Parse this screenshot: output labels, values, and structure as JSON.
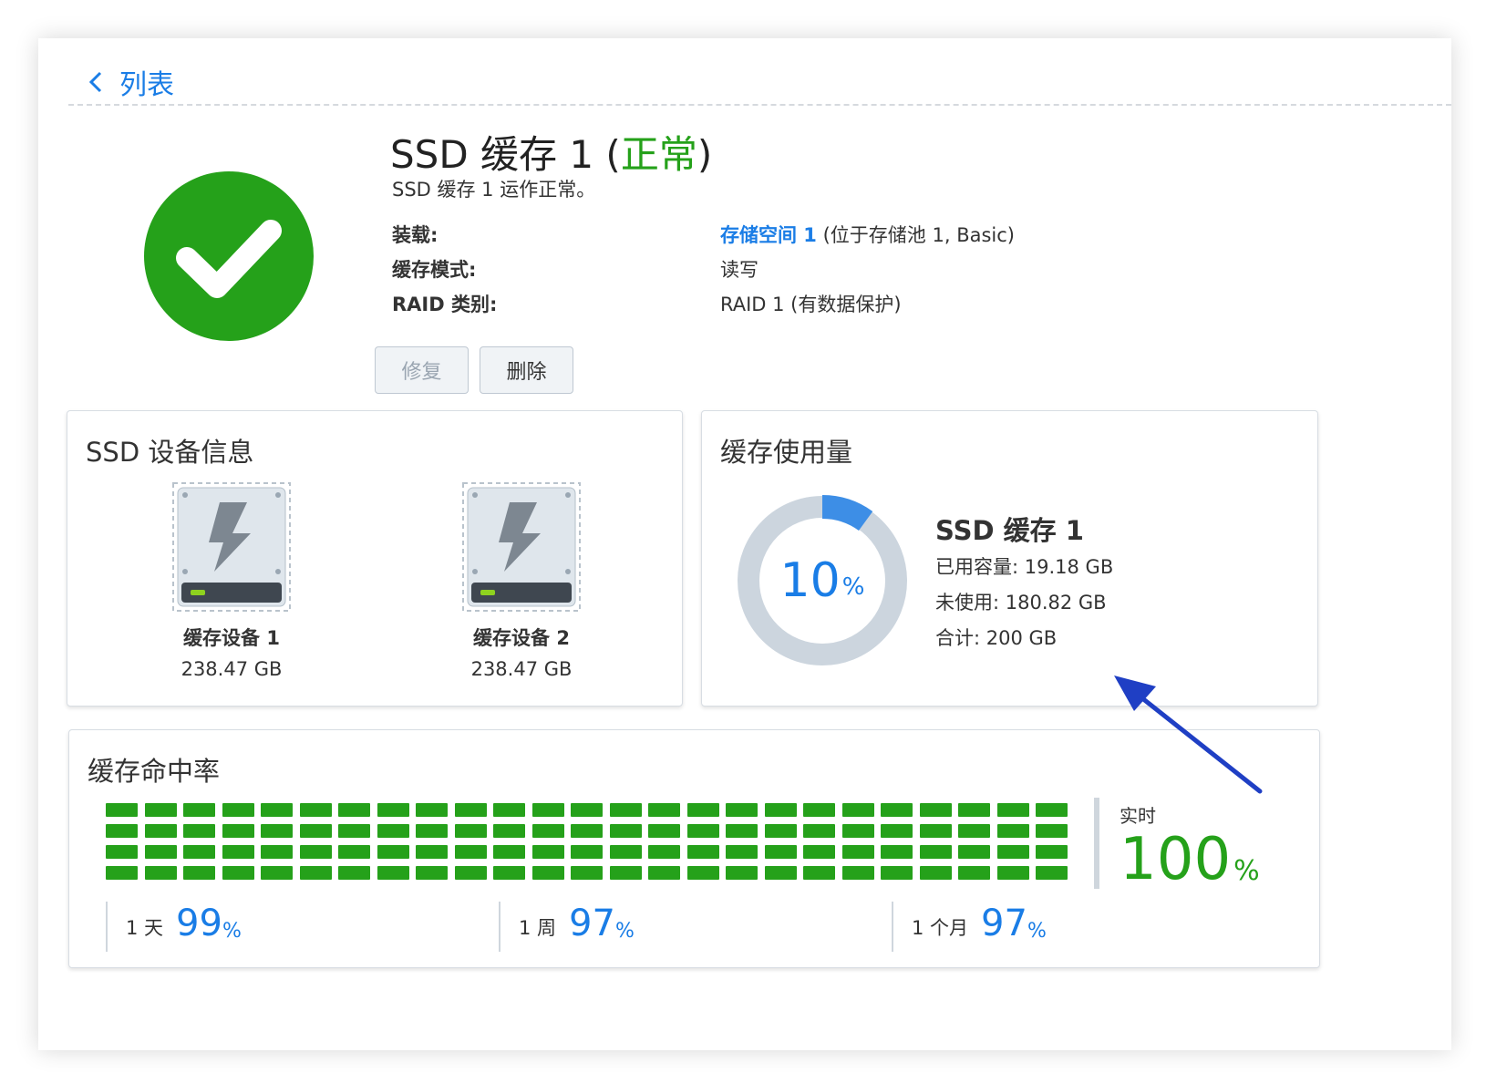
{
  "nav": {
    "back_label": "列表"
  },
  "header": {
    "title_prefix": "SSD 缓存 1 (",
    "title_status": "正常",
    "title_suffix": ")",
    "subtitle": "SSD 缓存 1 运作正常。",
    "status_color": "#25a11a"
  },
  "info": {
    "mount_label": "装载:",
    "mount_link": "存储空间 1",
    "mount_rest": " (位于存储池 1, Basic)",
    "mode_label": "缓存模式:",
    "mode_value": "读写",
    "raid_label": "RAID 类别:",
    "raid_value": "RAID 1 (有数据保护)"
  },
  "buttons": {
    "repair": "修复",
    "delete": "删除"
  },
  "ssd_panel": {
    "title": "SSD 设备信息",
    "devices": [
      {
        "name": "缓存设备 1",
        "size": "238.47 GB"
      },
      {
        "name": "缓存设备 2",
        "size": "238.47 GB"
      }
    ]
  },
  "usage_panel": {
    "title": "缓存使用量",
    "percent": "10",
    "percent_unit": "%",
    "cache_name": "SSD 缓存 1",
    "used": "已用容量: 19.18 GB",
    "unused": "未使用: 180.82 GB",
    "total": "合计: 200 GB",
    "used_fraction": 0.1,
    "accent": "#3d8ee6"
  },
  "hit_panel": {
    "title": "缓存命中率",
    "stats": [
      {
        "period": "1 天",
        "value": "99",
        "unit": "%"
      },
      {
        "period": "1 周",
        "value": "97",
        "unit": "%"
      },
      {
        "period": "1 个月",
        "value": "97",
        "unit": "%"
      }
    ],
    "realtime_label": "实时",
    "realtime_value": "100",
    "realtime_unit": "%",
    "bar_color": "#25a11a"
  },
  "annotation": {
    "arrow_color": "#1f3fc4"
  }
}
